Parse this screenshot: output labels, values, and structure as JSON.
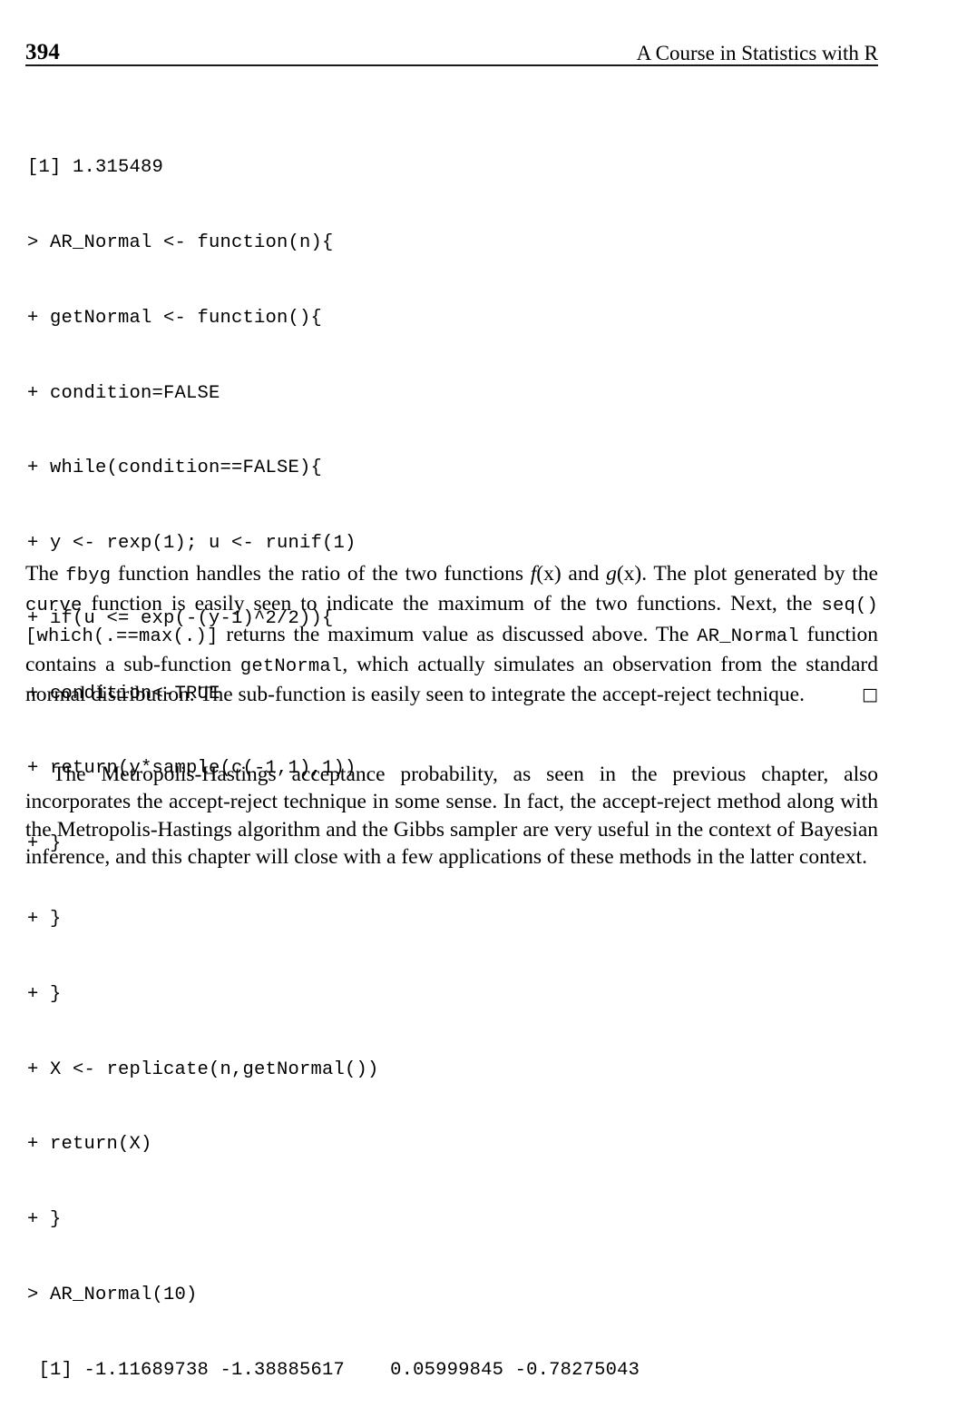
{
  "header": {
    "folio": "394",
    "running_title": "A Course in Statistics with R"
  },
  "code_block": {
    "lines": [
      "[1] 1.315489",
      "> AR_Normal <- function(n){",
      "+ getNormal <- function(){",
      "+ condition=FALSE",
      "+ while(condition==FALSE){",
      "+ y <- rexp(1); u <- runif(1)",
      "+ if(u <= exp(-(y-1)^2/2)){",
      "+ condition<-TRUE",
      "+ return(y*sample(c(-1,1),1))",
      "+ }",
      "+ }",
      "+ }",
      "+ X <- replicate(n,getNormal())",
      "+ return(X)",
      "+ }",
      "> AR_Normal(10)",
      " [1] -1.11689738 -1.38885617    0.05999845 -0.78275043"
    ]
  },
  "paragraphs": {
    "proof": {
      "t1": "The ",
      "c1": "fbyg",
      "t2": " function handles the ratio of the two functions ",
      "m1": "f",
      "m1b": "(x)",
      "t3": " and ",
      "m2": "g",
      "m2b": "(x)",
      "t4": ". The plot generated by the ",
      "c2": "curve",
      "t5": " function is easily seen to indicate the maximum of the two functions. Next, the ",
      "c3": "seq()[which(.==max(.)]",
      "t6": " returns the maximum value as discussed above. The ",
      "c4": "AR_Normal",
      "t7": " function contains a sub-function ",
      "c5": "getNormal",
      "t8": ", which actually simulates an observation from the standard normal distribution. The sub-function is easily seen to integrate the accept-reject technique.",
      "qed_symbol": "□"
    },
    "closing": {
      "text": "The Metropolis-Hastings acceptance probability, as seen in the previous chapter, also incorporates the accept-reject technique in some sense. In fact, the accept-reject method along with the Metropolis-Hastings algorithm and the Gibbs sampler are very useful in the context of Bayesian inference, and this chapter will close with a few applications of these methods in the latter context."
    }
  },
  "colors": {
    "text": "#000000",
    "rule": "#1a1a1a",
    "background": "#ffffff"
  }
}
